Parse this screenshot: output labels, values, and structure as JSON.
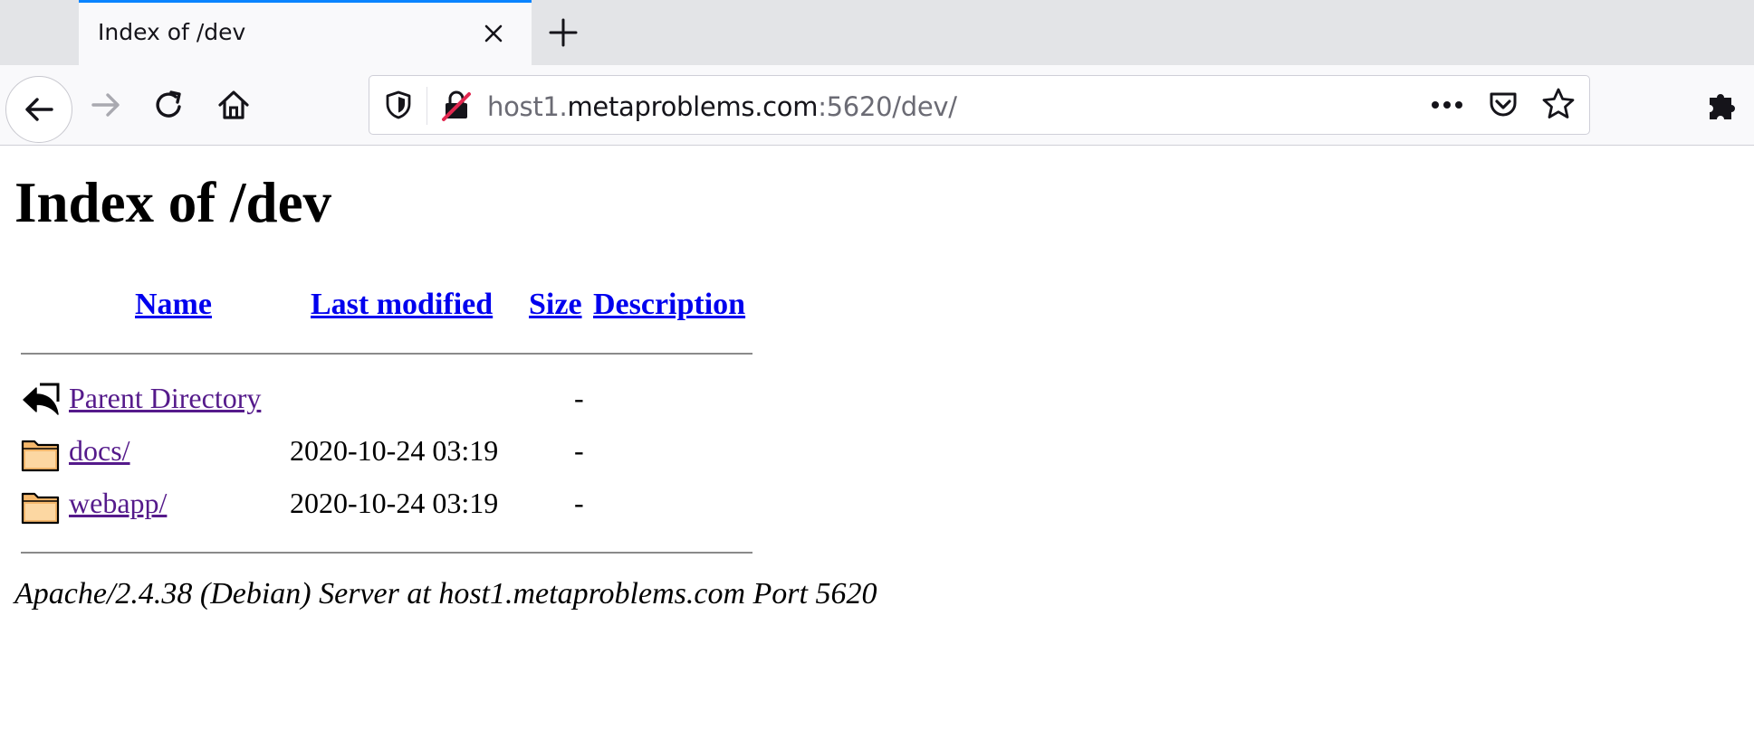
{
  "browser": {
    "tab_title": "Index of /dev",
    "url_prefix": "host1.",
    "url_domain": "metaproblems.com",
    "url_suffix": ":5620/dev/",
    "icons": {
      "close": "close-icon",
      "new_tab": "plus-icon",
      "back": "arrow-left-icon",
      "forward": "arrow-right-icon",
      "reload": "reload-icon",
      "home": "home-icon",
      "shield": "shield-icon",
      "insecure": "insecure-lock-icon",
      "more": "ellipsis-icon",
      "pocket": "pocket-icon",
      "bookmark": "star-icon",
      "extensions": "puzzle-icon"
    },
    "colors": {
      "accent": "#0a84ff",
      "insecure": "#e22850"
    }
  },
  "page": {
    "heading": "Index of /dev",
    "columns": {
      "name": "Name",
      "last_modified": "Last modified",
      "size": "Size",
      "description": "Description"
    },
    "rows": [
      {
        "icon": "back-icon",
        "name": "Parent Directory",
        "modified": "",
        "size": "-"
      },
      {
        "icon": "folder-icon",
        "name": "docs/",
        "modified": "2020-10-24 03:19",
        "size": "-"
      },
      {
        "icon": "folder-icon",
        "name": "webapp/",
        "modified": "2020-10-24 03:19",
        "size": "-"
      }
    ],
    "footer": "Apache/2.4.38 (Debian) Server at host1.metaproblems.com Port 5620",
    "link_color": "#0000ee",
    "visited_color": "#551a8b"
  }
}
